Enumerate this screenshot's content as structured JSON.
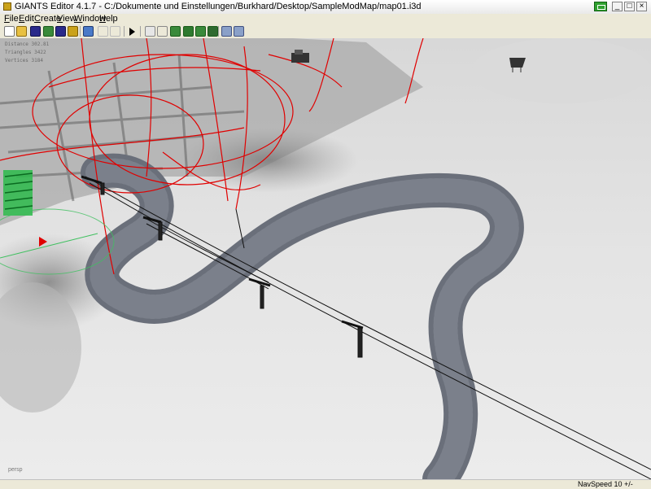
{
  "window": {
    "title": "GIANTS Editor 4.1.7 - C:/Dokumente und Einstellungen/Burkhard/Desktop/SampleModMap/map01.i3d",
    "minimize": "_",
    "maximize": "□",
    "close": "×"
  },
  "menu": {
    "file": {
      "accel": "F",
      "rest": "ile"
    },
    "edit": {
      "accel": "E",
      "rest": "dit"
    },
    "create": {
      "accel": "C",
      "rest": "reate"
    },
    "view": {
      "accel": "V",
      "rest": "iew"
    },
    "window": {
      "accel": "W",
      "rest": "indow"
    },
    "help": {
      "accel": "H",
      "rest": "elp"
    }
  },
  "toolbar": {
    "icons": [
      "new-file-icon",
      "open-file-icon",
      "save-icon",
      "save-as-icon",
      "refresh-icon",
      "undo-icon",
      "redo-icon",
      "play-icon",
      "select-icon",
      "move-icon",
      "terrain-sculpt-icon",
      "paint-icon",
      "foliage-icon",
      "plant-icon",
      "settings-icon",
      "zoom-icon"
    ]
  },
  "viewport": {
    "stats": {
      "distance": "Distance 302.81",
      "triangles": "Triangles 3422",
      "vertices": "Vertices 3184"
    },
    "camera_label": "persp",
    "colors": {
      "splines": "#e00000",
      "snow": "#e3e3e3",
      "road": "#6a6f7a"
    }
  },
  "status": {
    "navspeed": "NavSpeed 10 +/-"
  }
}
